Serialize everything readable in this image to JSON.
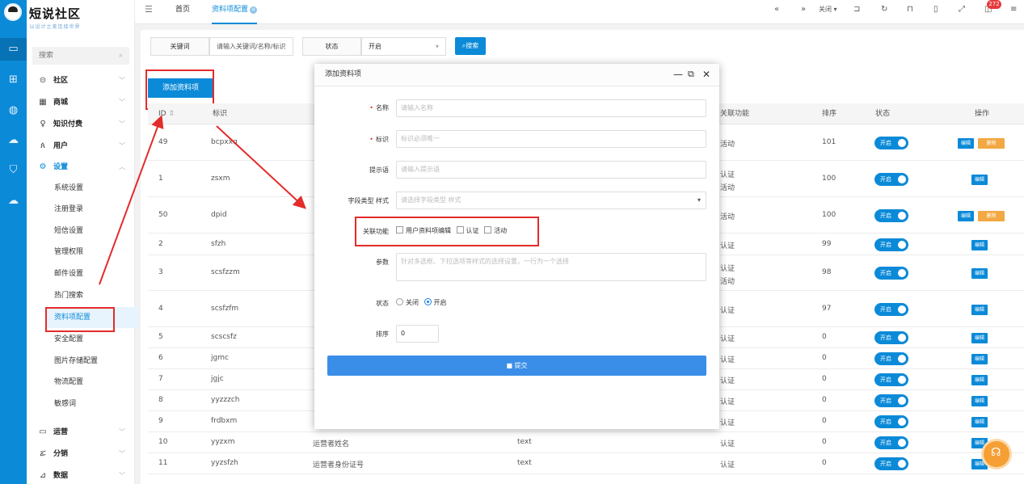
{
  "brand": {
    "name": "短说社区",
    "subtitle": "以设计之美连接世界"
  },
  "sidebar": {
    "search_placeholder": "搜索",
    "menus": [
      {
        "label": "社区",
        "icon": "community-icon"
      },
      {
        "label": "商城",
        "icon": "shop-icon"
      },
      {
        "label": "知识付费",
        "icon": "knowledge-icon"
      },
      {
        "label": "用户",
        "icon": "user-icon"
      },
      {
        "label": "设置",
        "icon": "settings-icon"
      }
    ],
    "sub_items": [
      "系统设置",
      "注册登录",
      "短信设置",
      "管理权限",
      "邮件设置",
      "热门搜索",
      "资料项配置",
      "安全配置",
      "图片存储配置",
      "物流配置",
      "敏感词"
    ],
    "bottom_menus": [
      {
        "label": "运营",
        "icon": "ops-icon"
      },
      {
        "label": "分销",
        "icon": "distribution-icon"
      },
      {
        "label": "数据",
        "icon": "data-icon"
      }
    ]
  },
  "topbar": {
    "tabs": [
      {
        "label": "首页"
      },
      {
        "label": "资料项配置"
      }
    ],
    "close_label": "关闭",
    "notification_count": "272"
  },
  "filter": {
    "keyword_label": "关键词",
    "keyword_placeholder": "请输入关键词/名称/标识",
    "status_label": "状态",
    "status_value": "开启",
    "search_button": "搜索"
  },
  "add_button": "添加资料项",
  "table": {
    "headers": {
      "id": "ID",
      "ident": "标识",
      "relation": "关联功能",
      "sort": "排序",
      "status": "状态",
      "ops": "操作"
    },
    "status_on": "开启",
    "edit_label": "编辑",
    "delete_label": "删除",
    "rows": [
      {
        "id": "49",
        "ident": "bcpxxq",
        "relation": "活动",
        "relation2": "",
        "sort": "101"
      },
      {
        "id": "1",
        "ident": "zsxm",
        "relation": "认证",
        "relation2": "活动",
        "sort": "100"
      },
      {
        "id": "50",
        "ident": "dpid",
        "relation": "活动",
        "relation2": "",
        "sort": "100"
      },
      {
        "id": "2",
        "ident": "sfzh",
        "relation": "认证",
        "relation2": "",
        "sort": "99"
      },
      {
        "id": "3",
        "ident": "scsfzzm",
        "relation": "认证",
        "relation2": "活动",
        "sort": "98"
      },
      {
        "id": "4",
        "ident": "scsfzfm",
        "relation": "认证",
        "relation2": "",
        "sort": "97"
      },
      {
        "id": "5",
        "ident": "scscsfz",
        "relation": "认证",
        "relation2": "",
        "sort": "0"
      },
      {
        "id": "6",
        "ident": "jgmc",
        "relation": "认证",
        "relation2": "",
        "sort": "0"
      },
      {
        "id": "7",
        "ident": "jgjc",
        "relation": "认证",
        "relation2": "",
        "sort": "0"
      },
      {
        "id": "8",
        "ident": "yyzzzch",
        "relation": "认证",
        "relation2": "",
        "sort": "0"
      },
      {
        "id": "9",
        "ident": "frdbxm",
        "relation": "认证",
        "relation2": "",
        "sort": "0"
      },
      {
        "id": "10",
        "ident": "yyzxm",
        "name": "运营者姓名",
        "type": "text",
        "relation": "认证",
        "relation2": "",
        "sort": "0"
      },
      {
        "id": "11",
        "ident": "yyzsfzh",
        "name": "运营者身份证号",
        "type": "text",
        "relation": "认证",
        "relation2": "",
        "sort": "0"
      }
    ]
  },
  "modal": {
    "title": "添加资料项",
    "fields": {
      "name_label": "名称",
      "name_placeholder": "请输入名称",
      "ident_label": "标识",
      "ident_placeholder": "标识必须唯一",
      "hint_label": "提示语",
      "hint_placeholder": "请输入提示语",
      "type_label": "字段类型 样式",
      "type_placeholder": "请选择字段类型 样式",
      "relation_label": "关联功能",
      "relation_options": [
        "用户资料项编辑",
        "认证",
        "活动"
      ],
      "param_label": "参数",
      "param_placeholder": "针对多选框、下拉选项等样式的选择设置，一行为一个选择",
      "status_label": "状态",
      "status_off": "关闭",
      "status_on": "开启",
      "sort_label": "排序",
      "sort_value": "0"
    },
    "submit": "提交"
  }
}
